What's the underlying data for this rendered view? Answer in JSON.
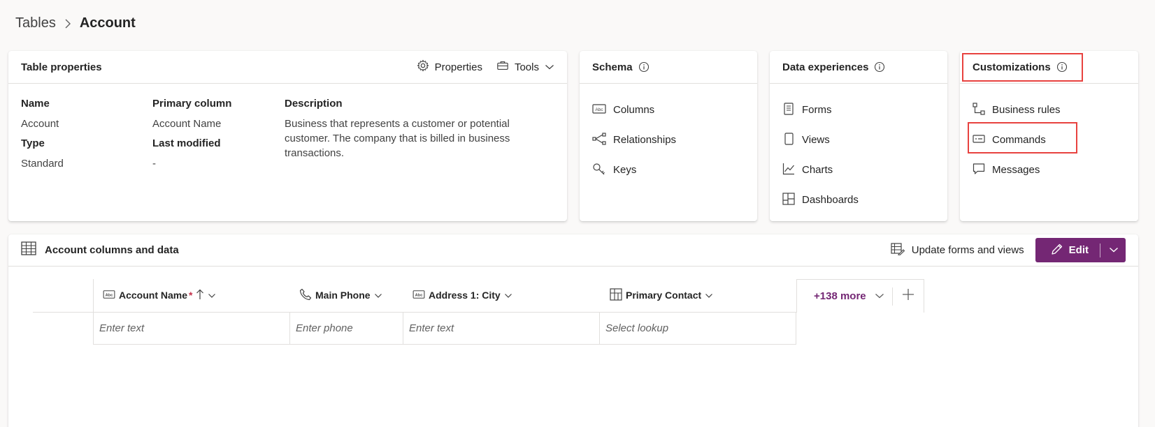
{
  "breadcrumb": {
    "parent": "Tables",
    "current": "Account"
  },
  "table_properties": {
    "title": "Table properties",
    "actions": {
      "properties": "Properties",
      "tools": "Tools"
    },
    "fields": {
      "name_label": "Name",
      "name_value": "Account",
      "primary_label": "Primary column",
      "primary_value": "Account Name",
      "desc_label": "Description",
      "desc_value": "Business that represents a customer or potential customer. The company that is billed in business transactions.",
      "type_label": "Type",
      "type_value": "Standard",
      "modified_label": "Last modified",
      "modified_value": "-"
    }
  },
  "schema": {
    "title": "Schema",
    "items": [
      "Columns",
      "Relationships",
      "Keys"
    ]
  },
  "data_experiences": {
    "title": "Data experiences",
    "items": [
      "Forms",
      "Views",
      "Charts",
      "Dashboards"
    ]
  },
  "customizations": {
    "title": "Customizations",
    "items": [
      "Business rules",
      "Commands",
      "Messages"
    ]
  },
  "data_section": {
    "title": "Account columns and data",
    "update_label": "Update forms and views",
    "edit_label": "Edit",
    "columns": [
      {
        "label": "Account Name",
        "required_mark": "*",
        "placeholder": "Enter text",
        "icon": "text-field-icon"
      },
      {
        "label": "Main Phone",
        "placeholder": "Enter phone",
        "icon": "phone-icon"
      },
      {
        "label": "Address 1: City",
        "placeholder": "Enter text",
        "icon": "text-field-icon"
      },
      {
        "label": "Primary Contact",
        "placeholder": "Select lookup",
        "icon": "lookup-icon"
      }
    ],
    "more_label": "+138 more"
  },
  "colors": {
    "accent": "#742774",
    "highlight": "#e8423f"
  }
}
